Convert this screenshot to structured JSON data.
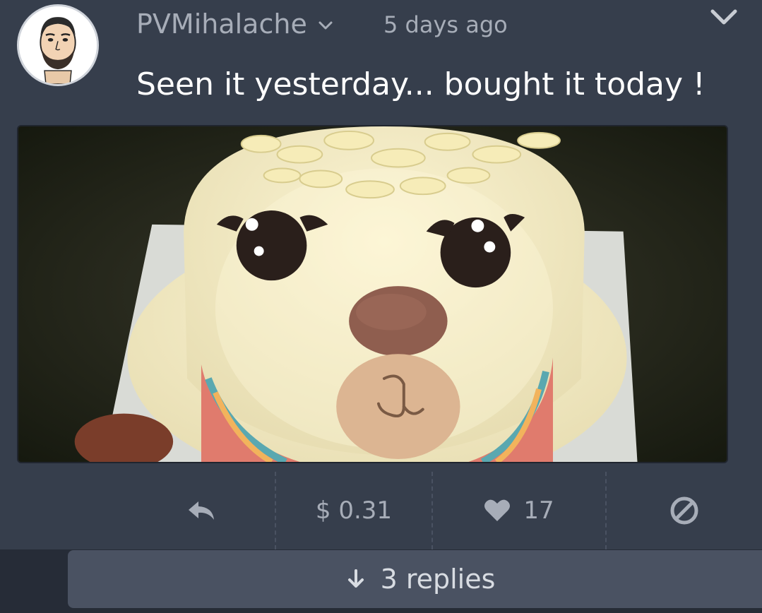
{
  "post": {
    "author": "PVMihalache",
    "time": "5 days ago",
    "text": "Seen it yesterday... bought it today !",
    "image_alt": "llama shaped cake"
  },
  "actions": {
    "payout": "$ 0.31",
    "likes": "17"
  },
  "replies": {
    "label": "3 replies"
  },
  "colors": {
    "background": "#363e4c",
    "text_muted": "#a7adb8",
    "text_primary": "#ffffff",
    "replies_button": "#4a5262"
  },
  "icons": [
    "chevron-down-icon",
    "collapse-icon",
    "reply-icon",
    "heart-icon",
    "block-icon",
    "arrow-down-icon"
  ]
}
